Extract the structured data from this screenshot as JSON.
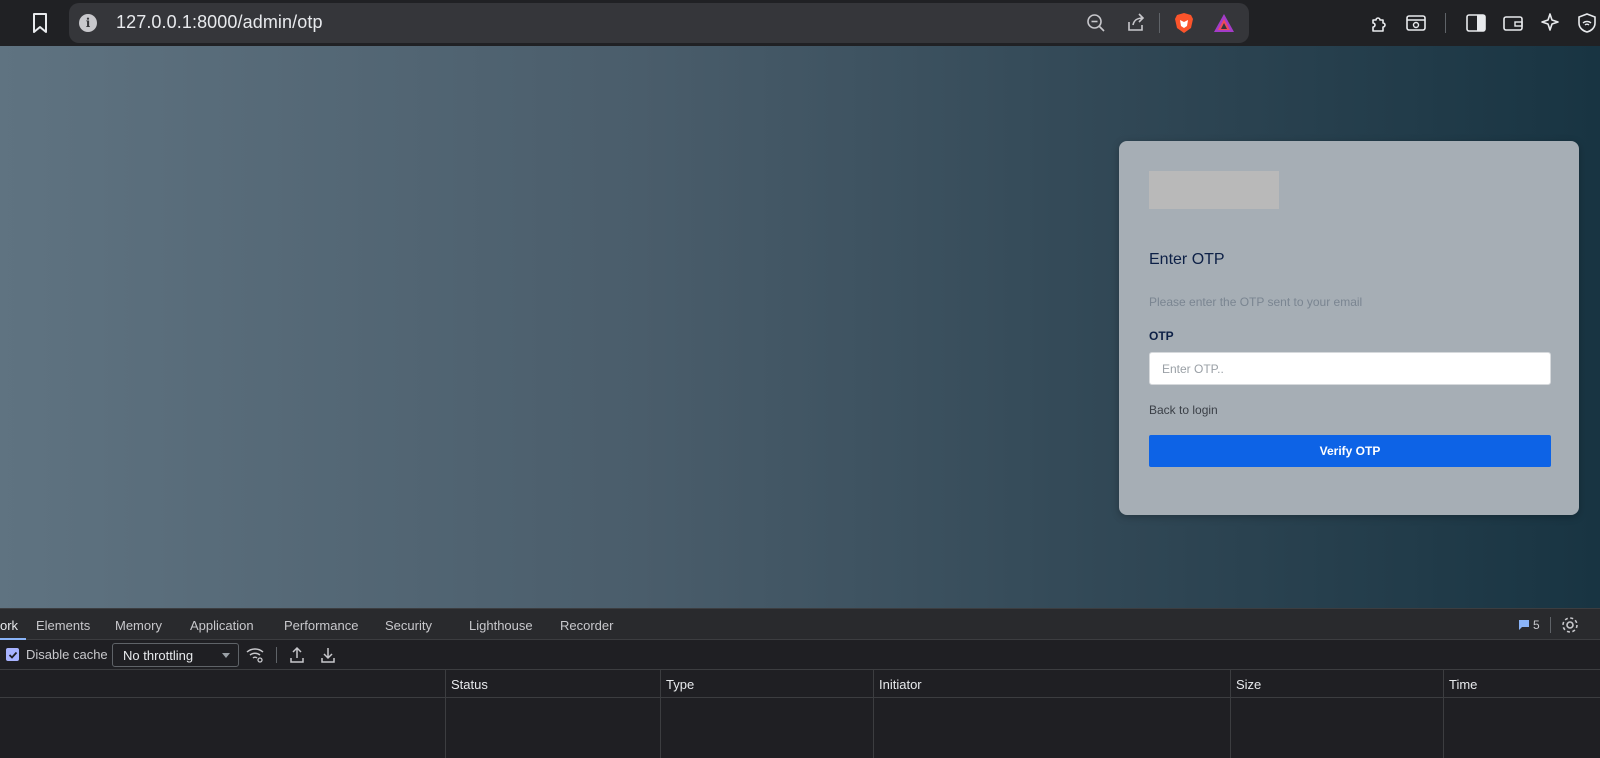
{
  "browser": {
    "url": "127.0.0.1:8000/admin/otp",
    "icons": [
      "bookmark-icon",
      "site-info-icon",
      "zoom-out-icon",
      "share-icon",
      "brave-shield-icon",
      "brave-rewards-icon",
      "extensions-icon",
      "screenshot-icon",
      "sidebar-icon",
      "wallet-icon",
      "leo-ai-icon",
      "vpn-icon"
    ]
  },
  "otp_card": {
    "title": "Enter OTP",
    "subtitle": "Please enter the OTP sent to your email",
    "otp_label": "OTP",
    "otp_placeholder": "Enter OTP..",
    "otp_value": "",
    "back_link": "Back to login",
    "submit_label": "Verify OTP",
    "colors": {
      "button": "#0d63e6",
      "title": "#0d2046"
    }
  },
  "devtools": {
    "tabs": [
      "ork",
      "Elements",
      "Memory",
      "Application",
      "Performance",
      "Security",
      "Lighthouse",
      "Recorder"
    ],
    "active_tab": "ork",
    "message_count": "5",
    "toolbar": {
      "disable_cache_label": "Disable cache",
      "disable_cache_checked": true,
      "throttling": "No throttling"
    },
    "columns": [
      "Status",
      "Type",
      "Initiator",
      "Size",
      "Time"
    ]
  }
}
